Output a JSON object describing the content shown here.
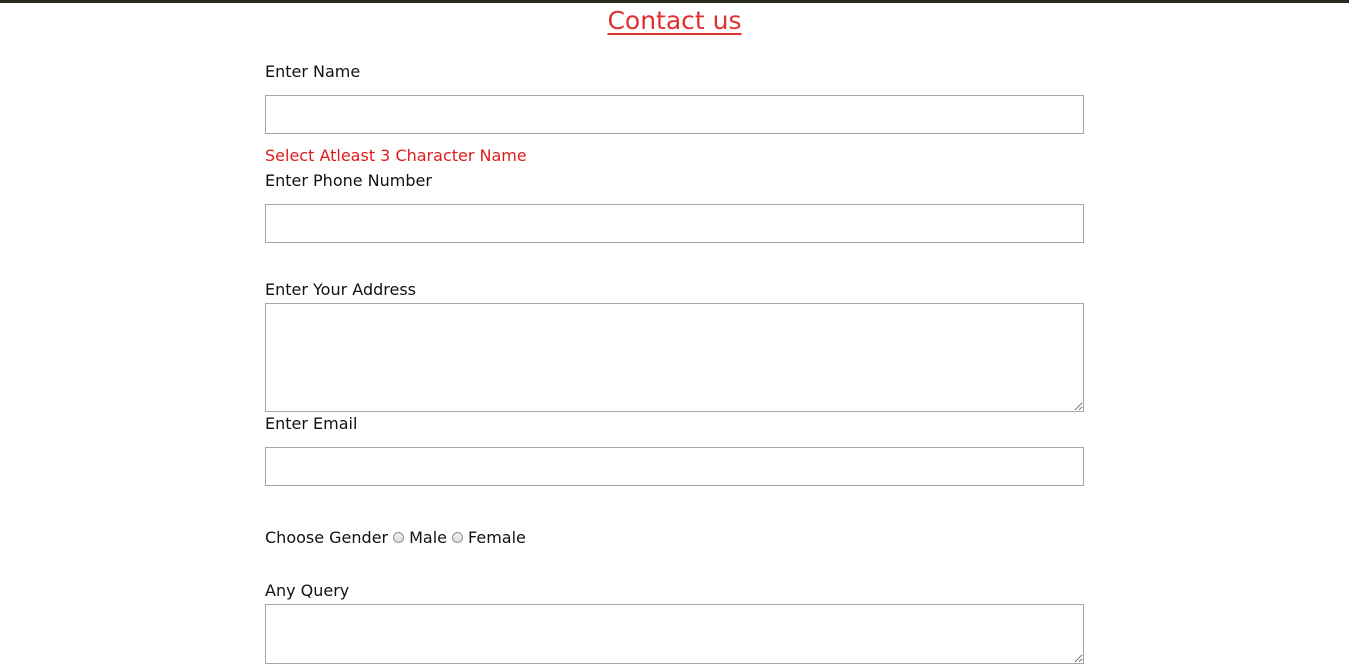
{
  "page": {
    "title": "Contact us"
  },
  "form": {
    "name": {
      "label": "Enter Name",
      "value": "",
      "error": "Select Atleast 3 Character Name"
    },
    "phone": {
      "label": "Enter Phone Number",
      "value": ""
    },
    "address": {
      "label": "Enter Your Address",
      "value": ""
    },
    "email": {
      "label": "Enter Email",
      "value": ""
    },
    "gender": {
      "label": "Choose Gender",
      "options": [
        "Male",
        "Female"
      ],
      "selected": ""
    },
    "query": {
      "label": "Any Query",
      "value": ""
    }
  },
  "colors": {
    "title": "#e03131",
    "error": "#e01b1b",
    "border": "#a7a7a7"
  }
}
